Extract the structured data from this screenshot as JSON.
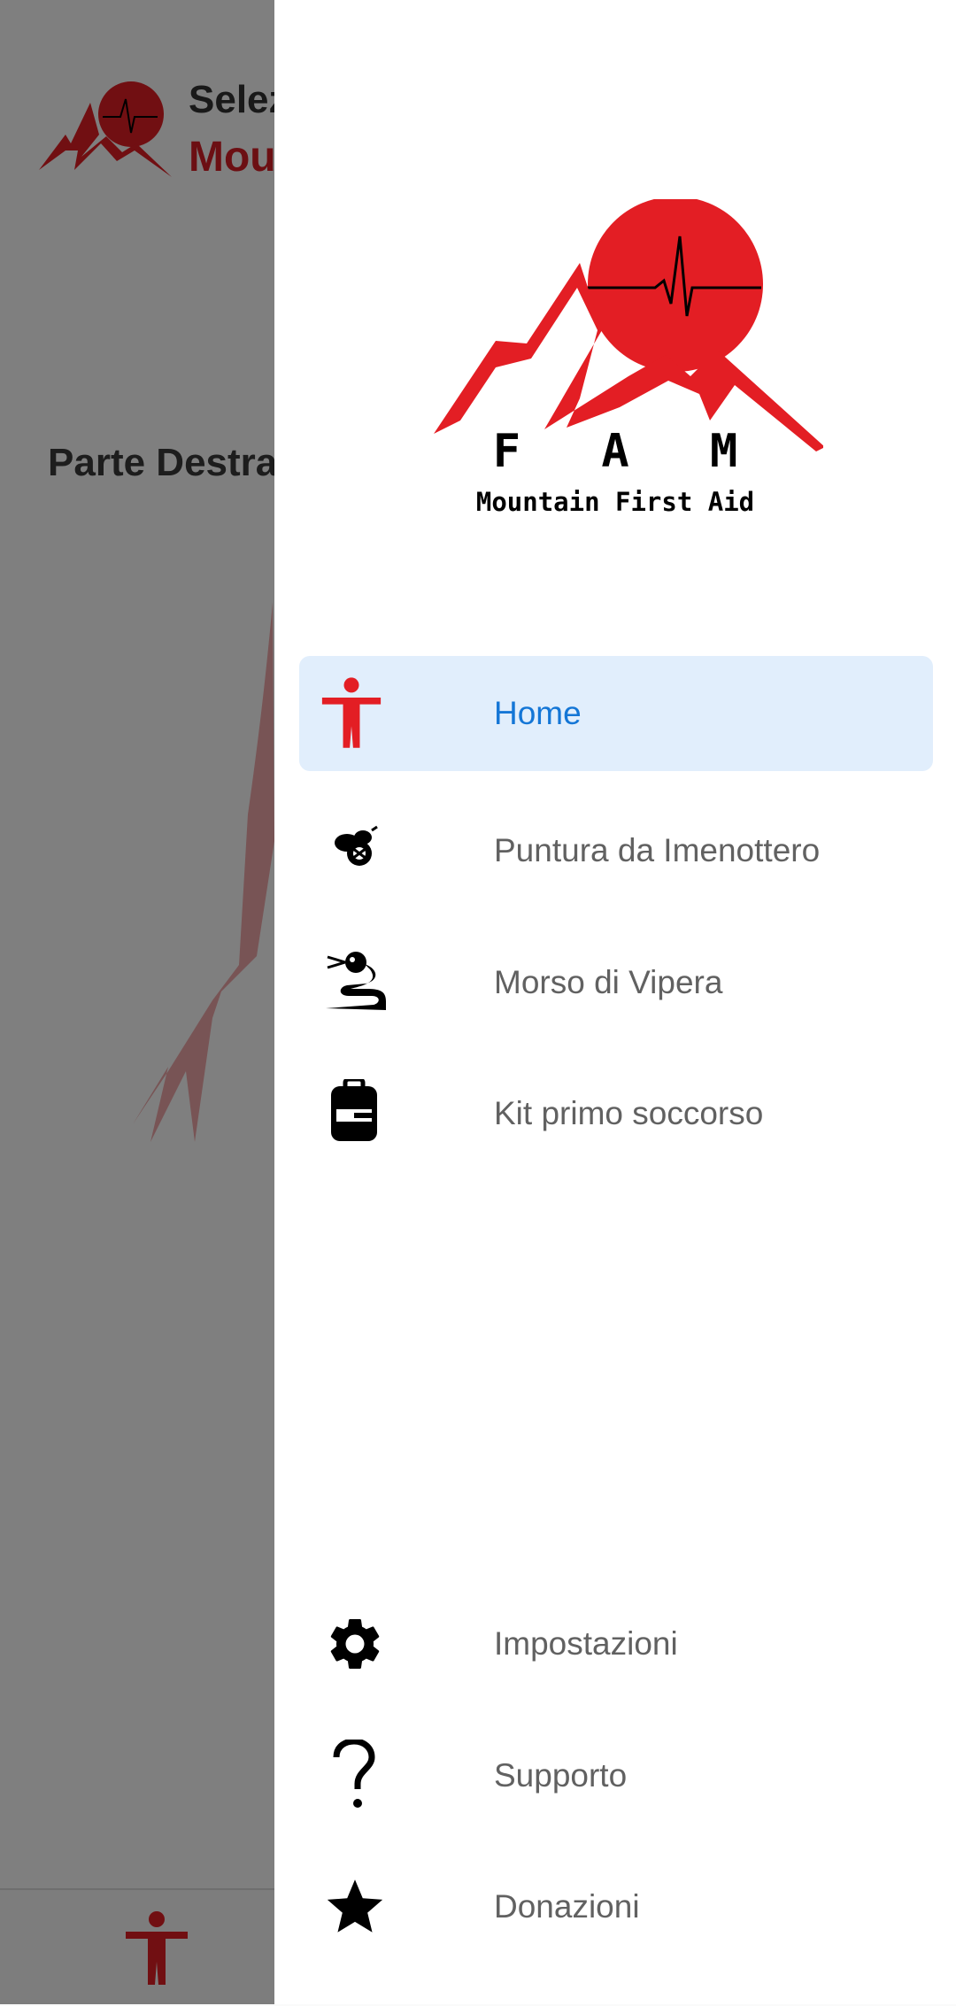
{
  "background": {
    "header_title_line1": "Selez",
    "header_title_line2": "Mou",
    "section_title": "Parte Destra"
  },
  "drawer": {
    "brand_name": "F A M",
    "brand_tagline": "Mountain First Aid",
    "menu": [
      {
        "label": "Home",
        "icon": "person-icon",
        "active": true
      },
      {
        "label": "Puntura da Imenottero",
        "icon": "bee-icon",
        "active": false
      },
      {
        "label": "Morso di Vipera",
        "icon": "snake-icon",
        "active": false
      },
      {
        "label": "Kit primo soccorso",
        "icon": "backpack-icon",
        "active": false
      }
    ],
    "footer_menu": [
      {
        "label": "Impostazioni",
        "icon": "gear-icon"
      },
      {
        "label": "Supporto",
        "icon": "question-icon"
      },
      {
        "label": "Donazioni",
        "icon": "star-icon"
      }
    ]
  },
  "colors": {
    "brand_red": "#e31e24",
    "active_blue": "#1476d6",
    "active_bg": "#e1eefc",
    "scrim": "rgba(0,0,0,0.5)"
  }
}
